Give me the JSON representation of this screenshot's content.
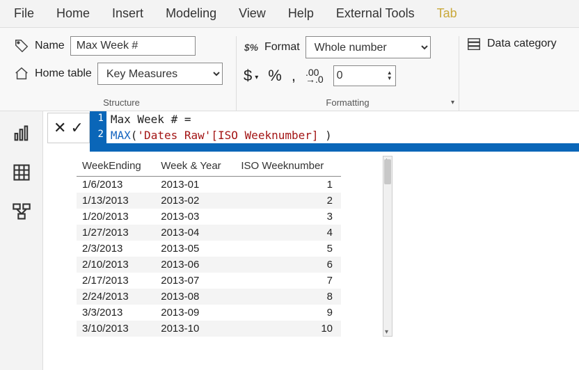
{
  "tabs": {
    "file": "File",
    "home": "Home",
    "insert": "Insert",
    "modeling": "Modeling",
    "view": "View",
    "help": "Help",
    "external": "External Tools",
    "active_partial": "Tab"
  },
  "structure": {
    "name_label": "Name",
    "name_value": "Max Week #",
    "hometable_label": "Home table",
    "hometable_value": "Key Measures",
    "group_title": "Structure"
  },
  "formatting": {
    "format_label": "Format",
    "format_value": "Whole number",
    "decimal_value": "0",
    "group_title": "Formatting"
  },
  "datacategory": {
    "label": "Data category"
  },
  "formula": {
    "line1_num": "1",
    "line1": "Max Week # =",
    "line2_num": "2",
    "fn": "MAX",
    "open": "(",
    "str": "'Dates Raw'[ISO Weeknumber]",
    "close": " )"
  },
  "table": {
    "headers": {
      "c1": "WeekEnding",
      "c2": "Week & Year",
      "c3": "ISO Weeknumber"
    },
    "rows": [
      {
        "c1": "1/6/2013",
        "c2": "2013-01",
        "c3": "1"
      },
      {
        "c1": "1/13/2013",
        "c2": "2013-02",
        "c3": "2"
      },
      {
        "c1": "1/20/2013",
        "c2": "2013-03",
        "c3": "3"
      },
      {
        "c1": "1/27/2013",
        "c2": "2013-04",
        "c3": "4"
      },
      {
        "c1": "2/3/2013",
        "c2": "2013-05",
        "c3": "5"
      },
      {
        "c1": "2/10/2013",
        "c2": "2013-06",
        "c3": "6"
      },
      {
        "c1": "2/17/2013",
        "c2": "2013-07",
        "c3": "7"
      },
      {
        "c1": "2/24/2013",
        "c2": "2013-08",
        "c3": "8"
      },
      {
        "c1": "3/3/2013",
        "c2": "2013-09",
        "c3": "9"
      },
      {
        "c1": "3/10/2013",
        "c2": "2013-10",
        "c3": "10"
      }
    ]
  }
}
